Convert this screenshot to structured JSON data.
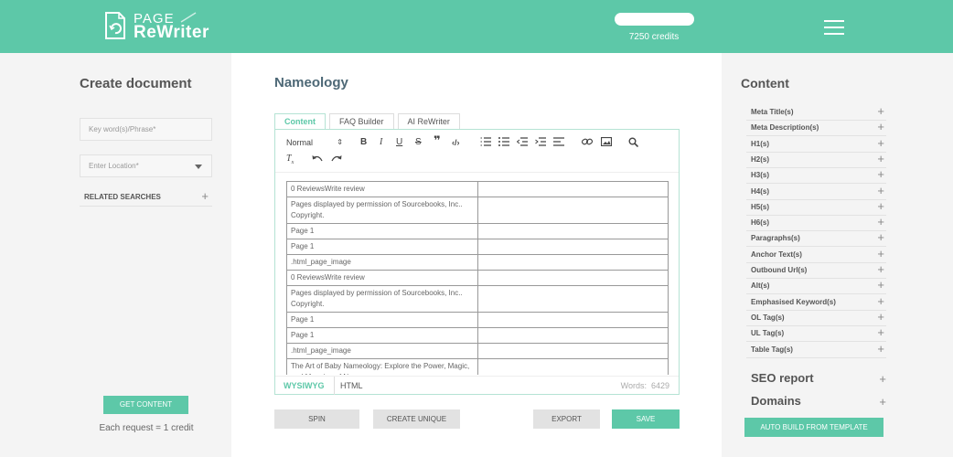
{
  "header": {
    "logo_page": "PAGE",
    "logo_rewriter": "ReWriter",
    "credits": "7250 credits"
  },
  "left": {
    "title": "Create document",
    "keyword_placeholder": "Key word(s)/Phrase*",
    "location_placeholder": "Enter Location*",
    "related_searches": "RELATED SEARCHES",
    "get_content": "GET CONTENT",
    "request_note": "Each request = 1 credit"
  },
  "center": {
    "doc_title": "Nameology",
    "tabs": [
      {
        "label": "Content"
      },
      {
        "label": "FAQ Builder"
      },
      {
        "label": "AI ReWriter"
      }
    ],
    "toolbar": {
      "format": "Normal",
      "format_arrow": "⇕"
    },
    "table_rows": [
      "0 ReviewsWrite review",
      "Pages displayed by permission of Sourcebooks, Inc.. Copyright.",
      "Page 1",
      "Page 1",
      ".html_page_image",
      "0 ReviewsWrite review",
      "Pages displayed by permission of Sourcebooks, Inc.. Copyright.",
      "Page 1",
      "Page 1",
      ".html_page_image",
      "The Art of Baby Nameology: Explore the Power, Magic, and Meaning of Names"
    ],
    "footer": {
      "wysiwyg": "WYSIWYG",
      "html": "HTML",
      "words_label": "Words:",
      "words_count": "6429"
    },
    "buttons": {
      "spin": "SPIN",
      "create_unique": "CREATE UNIQUE",
      "export": "EXPORT",
      "save": "SAVE"
    }
  },
  "right": {
    "title": "Content",
    "items": [
      "Meta Title(s)",
      "Meta Description(s)",
      "H1(s)",
      "H2(s)",
      "H3(s)",
      "H4(s)",
      "H5(s)",
      "H6(s)",
      "Paragraphs(s)",
      "Anchor Text(s)",
      "Outbound Url(s)",
      "Alt(s)",
      "Emphasised Keyword(s)",
      "OL Tag(s)",
      "UL Tag(s)",
      "Table Tag(s)"
    ],
    "seo_report": "SEO report",
    "domains": "Domains",
    "auto_build": "AUTO BUILD FROM TEMPLATE",
    "plus": "+"
  },
  "colors": {
    "accent": "#5dc8a8",
    "title_dark": "#4d6876"
  },
  "icons": [
    "logo-document-icon",
    "menu-icon",
    "chevron-down-icon",
    "plus-icon",
    "bold-icon",
    "italic-icon",
    "underline-icon",
    "strikethrough-icon",
    "quote-icon",
    "code-icon",
    "ordered-list-icon",
    "bullet-list-icon",
    "outdent-icon",
    "indent-icon",
    "align-icon",
    "link-icon",
    "image-icon",
    "search-icon",
    "clear-format-icon",
    "undo-icon",
    "redo-icon"
  ]
}
